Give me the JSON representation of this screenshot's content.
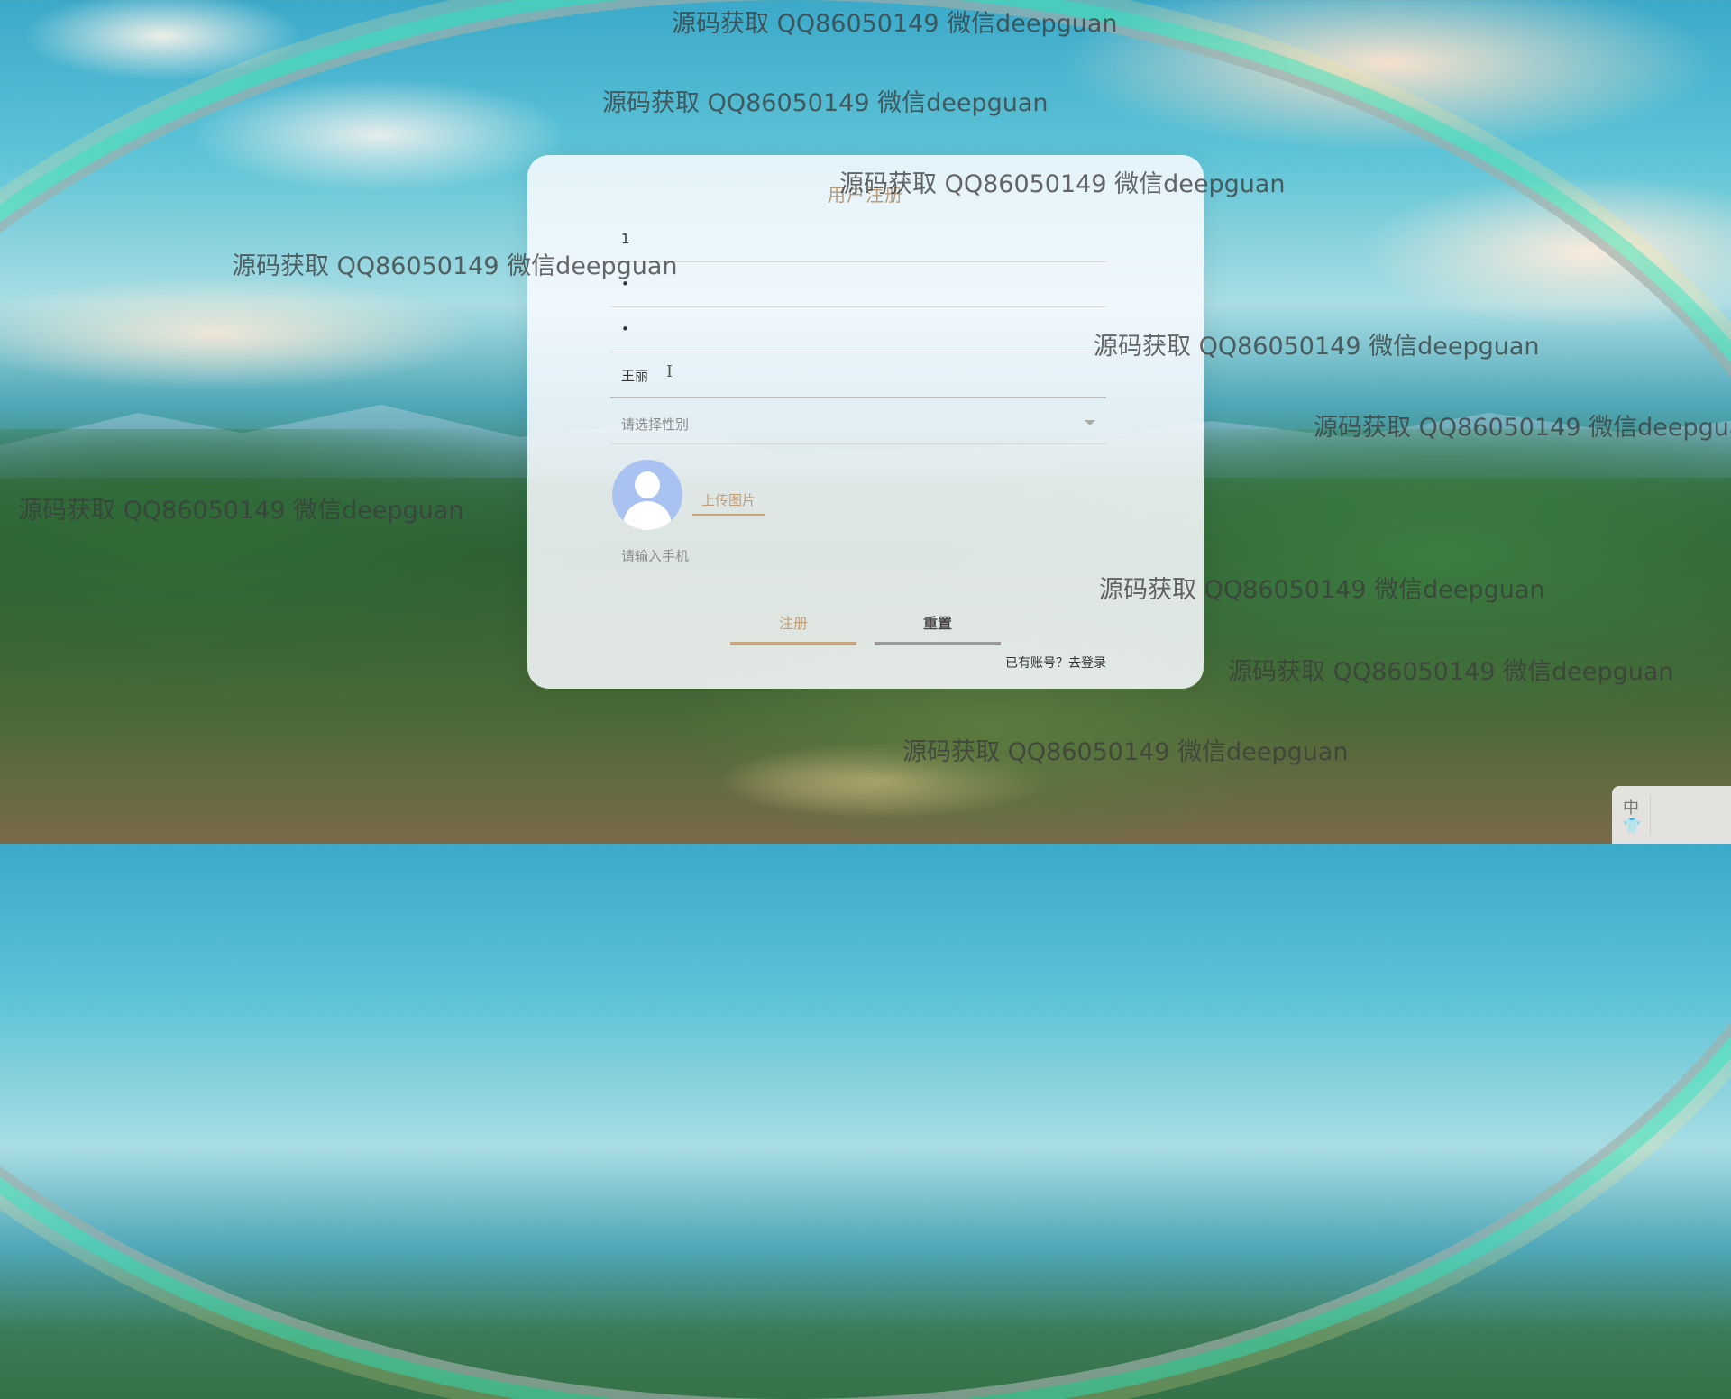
{
  "watermark_text": "源码获取 QQ86050149 微信deepguan",
  "form": {
    "title": "用户注册",
    "account_value": "1",
    "password_value": "•",
    "confirm_password_value": "•",
    "name_value": "王丽",
    "gender_placeholder": "请选择性别",
    "upload_label": "上传图片",
    "phone_placeholder": "请输入手机",
    "register_label": "注册",
    "reset_label": "重置",
    "login_link": "已有账号？去登录"
  },
  "ime": {
    "key1": "中",
    "key2": "👕"
  }
}
